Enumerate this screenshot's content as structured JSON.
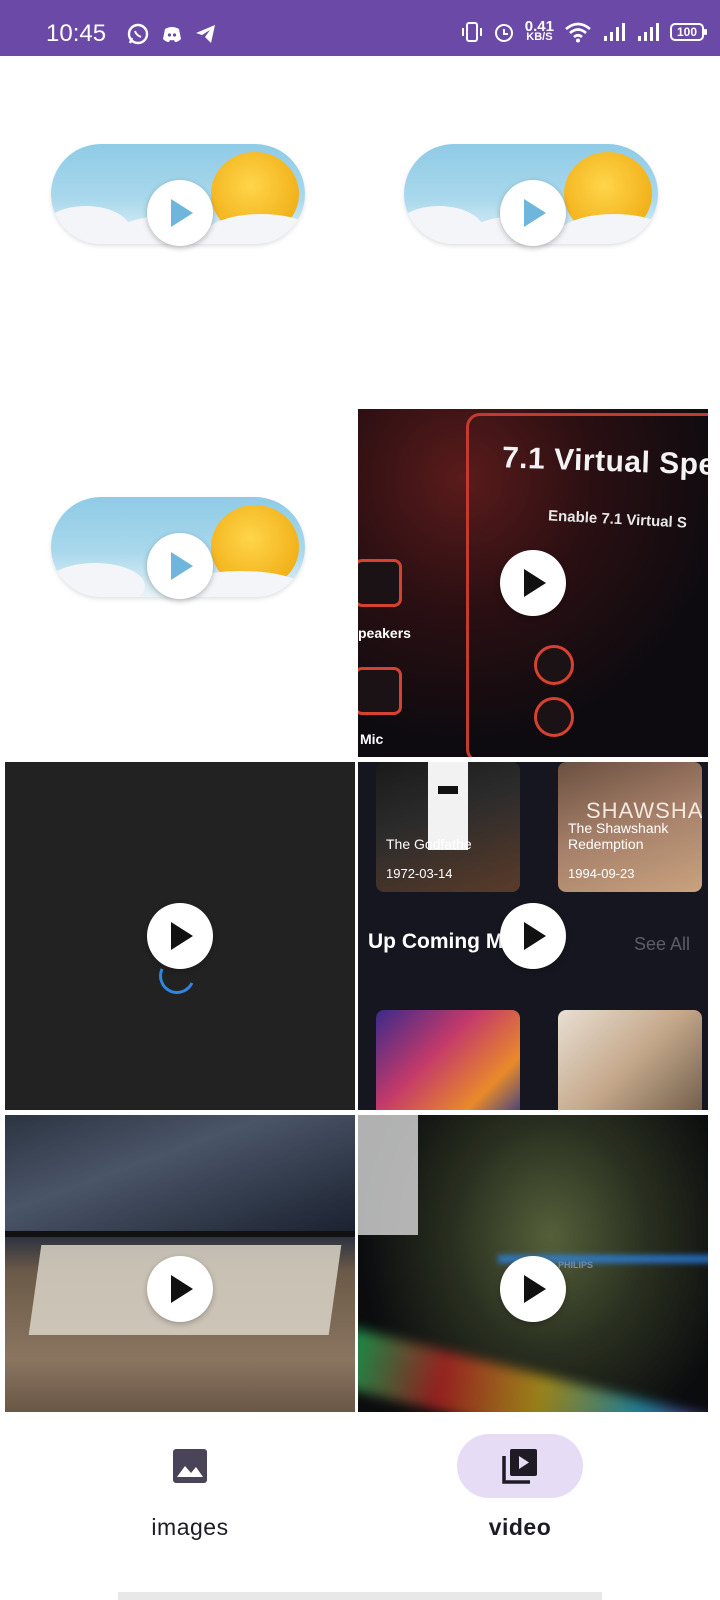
{
  "status_bar": {
    "time": "10:45",
    "speed_value": "0.41",
    "speed_unit": "KB/S",
    "battery": "100",
    "left_icons": [
      "whatsapp-icon",
      "discord-icon",
      "telegram-icon"
    ],
    "right_icons": [
      "vibrate-icon",
      "alarm-icon",
      "wifi-icon",
      "signal-icon",
      "signal-icon"
    ]
  },
  "gallery": {
    "videos": [
      {
        "kind": "weather-toggle"
      },
      {
        "kind": "weather-toggle"
      },
      {
        "kind": "weather-toggle"
      },
      {
        "kind": "screen-recording",
        "title_text": "7.1 Virtual Spe",
        "sub_text": "Enable 7.1 Virtual S",
        "labels": [
          "peakers",
          "Mic"
        ]
      },
      {
        "kind": "loading"
      },
      {
        "kind": "movie-app",
        "posters": [
          {
            "title": "The Godfathe",
            "date": "1972-03-14"
          },
          {
            "title": "The Shawshank Redemption",
            "date": "1994-09-23",
            "overlay": "SHAWSHANK"
          }
        ],
        "section_title": "Up Coming Movies",
        "see_all": "See All"
      },
      {
        "kind": "room-photo"
      },
      {
        "kind": "pc-desk",
        "monitor_brand": "PHILIPS"
      }
    ]
  },
  "bottom_nav": {
    "items": [
      {
        "label": "images",
        "icon": "image-icon",
        "active": false
      },
      {
        "label": "video",
        "icon": "video-library-icon",
        "active": true
      }
    ]
  },
  "colors": {
    "status_bar": "#6b49a6",
    "active_pill": "#e6dcf5",
    "spinner": "#2f86e0"
  }
}
